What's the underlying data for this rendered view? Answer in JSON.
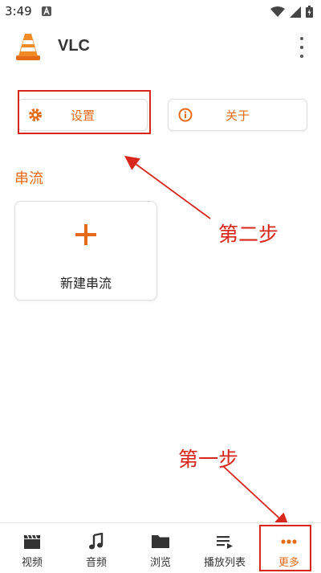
{
  "status_bar": {
    "time": "3:49",
    "icons": [
      "notification-a-icon",
      "wifi-icon",
      "signal-icon",
      "battery-charging-icon"
    ]
  },
  "app_bar": {
    "title": "VLC",
    "logo_icon": "vlc-cone-icon",
    "overflow_icon": "more-vertical-icon"
  },
  "actions": [
    {
      "label": "设置",
      "icon": "gear-icon"
    },
    {
      "label": "关于",
      "icon": "info-icon"
    }
  ],
  "stream_section": {
    "title": "串流",
    "new_stream_label": "新建串流",
    "new_stream_icon": "plus-icon"
  },
  "annotations": {
    "step_two": "第二步",
    "step_one": "第一步"
  },
  "bottom_nav": {
    "items": [
      {
        "label": "视频",
        "icon": "clapperboard-icon"
      },
      {
        "label": "音频",
        "icon": "music-note-icon"
      },
      {
        "label": "浏览",
        "icon": "folder-icon"
      },
      {
        "label": "播放列表",
        "icon": "playlist-icon"
      },
      {
        "label": "更多",
        "icon": "more-horizontal-icon"
      }
    ],
    "active": "更多"
  },
  "colors": {
    "accent": "#e56b1a",
    "annotation_red": "#d8261c"
  }
}
